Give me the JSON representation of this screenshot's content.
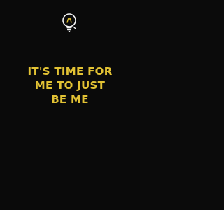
{
  "cover": {
    "background_color": "#0a0a0a",
    "accent_color": "#e2c234",
    "icon": "lightbulb-icon",
    "title_lines": [
      "IT'S TIME FOR",
      "ME TO JUST",
      "BE ME"
    ]
  }
}
